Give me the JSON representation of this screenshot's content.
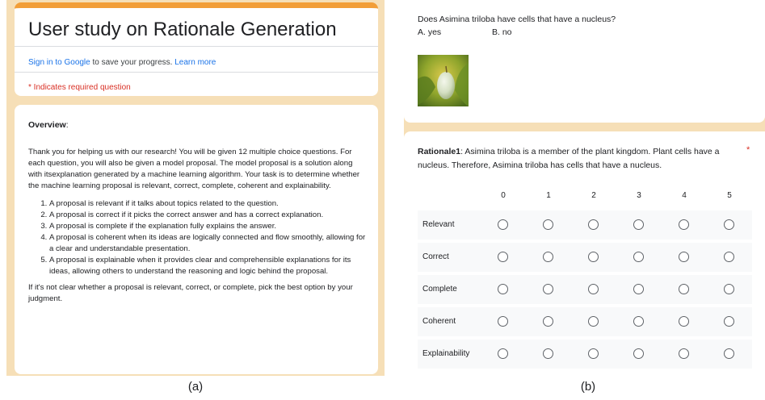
{
  "panel_a": {
    "form_title": "User study on Rationale Generation",
    "sign_in_link": "Sign in to Google",
    "sign_in_text": " to save your progress. ",
    "learn_more": "Learn more",
    "required_note": "* Indicates required question",
    "overview": {
      "heading": "Overview",
      "heading_suffix": ":",
      "intro": "Thank you for helping us with our research! You will be given 12 multiple choice questions. For each question, you will also be given a model proposal. The model proposal is a solution along with itsexplanation generated by a machine learning algorithm. Your task is to determine whether the machine learning proposal is relevant, correct, complete, coherent and explainability.",
      "criteria": [
        "A proposal is relevant if it talks about topics related to the question.",
        "A proposal is correct if it picks the correct answer and has a correct explanation.",
        "A proposal is complete if the explanation fully explains the answer.",
        "A proposal is coherent when its ideas are logically connected and flow smoothly, allowing for a clear and understandable presentation.",
        "A proposal is explainable when it provides clear and comprehensible explanations for its ideas, allowing others to understand the reasoning and logic behind the proposal."
      ],
      "footer": "If it's not clear whether a proposal is relevant, correct, or complete, pick the best option by your judgment."
    }
  },
  "panel_b": {
    "question": "Does Asimina triloba have cells that have a nucleus?",
    "option_a": "A. yes",
    "option_b": "B. no",
    "rationale_label": "Rationale1",
    "rationale_text": ":  Asimina triloba is a member of the plant kingdom. Plant cells have a nucleus. Therefore, Asimina triloba has cells that have a nucleus.",
    "required_star": "*",
    "columns": [
      "0",
      "1",
      "2",
      "3",
      "4",
      "5"
    ],
    "rows": [
      "Relevant",
      "Correct",
      "Complete",
      "Coherent",
      "Explainability"
    ]
  },
  "captions": {
    "a": "(a)",
    "b": "(b)"
  },
  "colors": {
    "panel_bg": "#f6dfb7",
    "accent": "#f29e38",
    "required": "#d93025",
    "link": "#1a73e8"
  }
}
